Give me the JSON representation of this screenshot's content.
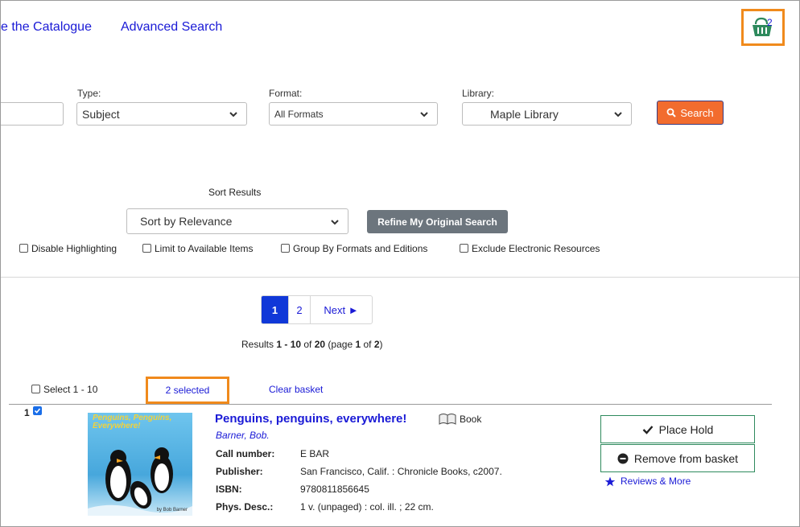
{
  "nav": {
    "search_catalogue": "e the Catalogue",
    "advanced_search": "Advanced Search"
  },
  "basket": {
    "count": "2",
    "icon": "basket-icon",
    "accent": "#2e8a5d",
    "highlight": "#f08a1c"
  },
  "search_form": {
    "type_label": "Type:",
    "type_value": "Subject",
    "format_label": "Format:",
    "format_value": "All Formats",
    "library_label": "Library:",
    "library_value": "Maple Library",
    "search_button": "Search",
    "search_button_color": "#f26c2e"
  },
  "sort": {
    "heading": "Sort Results",
    "value": "Sort by Relevance",
    "refine_button": "Refine My Original Search"
  },
  "filters": [
    {
      "label": "Disable Highlighting",
      "checked": false
    },
    {
      "label": "Limit to Available Items",
      "checked": false
    },
    {
      "label": "Group By Formats and Editions",
      "checked": false
    },
    {
      "label": "Exclude Electronic Resources",
      "checked": false
    }
  ],
  "pagination": {
    "pages": [
      "1",
      "2"
    ],
    "current": "1",
    "next": "Next ►"
  },
  "results_summary": {
    "prefix": "Results ",
    "range": "1 - 10",
    "of": " of ",
    "total": "20",
    "page_prefix": " (page ",
    "page": "1",
    "page_of": " of ",
    "page_total": "2",
    "suffix": ")"
  },
  "selection_bar": {
    "select_label": "Select 1 - 10",
    "selected_label": "2 selected",
    "clear_label": "Clear basket"
  },
  "result": {
    "number": "1",
    "checked": true,
    "title": "Penguins, penguins, everywhere!",
    "format": "Book",
    "author": "Barner, Bob.",
    "fields": [
      {
        "label": "Call number:",
        "value": "E BAR"
      },
      {
        "label": "Publisher:",
        "value": "San Francisco, Calif. : Chronicle Books, c2007."
      },
      {
        "label": "ISBN:",
        "value": "9780811856645"
      },
      {
        "label": "Phys. Desc.:",
        "value": "1 v. (unpaged) : col. ill. ; 22 cm."
      }
    ],
    "place_hold": "Place Hold",
    "remove_basket": "Remove from basket",
    "reviews": "Reviews & More",
    "cover_title": "Penguins, Penguins, Everywhere!",
    "cover_author": "by Bob Barner"
  }
}
